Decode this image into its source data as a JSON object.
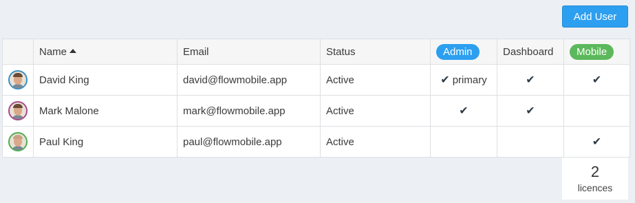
{
  "toolbar": {
    "add_user_label": "Add User"
  },
  "table": {
    "columns": {
      "name": "Name",
      "email": "Email",
      "status": "Status",
      "admin": "Admin",
      "dashboard": "Dashboard",
      "mobile": "Mobile"
    },
    "sort": {
      "column": "name",
      "direction": "ascending",
      "icon": "caret-up-icon"
    },
    "role_colors": {
      "admin": "#2d9ff0",
      "mobile": "#5cb85c"
    },
    "check_icon": "checkmark-icon",
    "rows": [
      {
        "name": "David King",
        "email": "david@flowmobile.app",
        "status": "Active",
        "admin": "primary",
        "admin_checked": true,
        "dashboard_checked": true,
        "mobile_checked": true,
        "avatar_ring": "#3b8fc0"
      },
      {
        "name": "Mark Malone",
        "email": "mark@flowmobile.app",
        "status": "Active",
        "admin": "",
        "admin_checked": true,
        "dashboard_checked": true,
        "mobile_checked": false,
        "avatar_ring": "#a84a8a"
      },
      {
        "name": "Paul King",
        "email": "paul@flowmobile.app",
        "status": "Active",
        "admin": "",
        "admin_checked": false,
        "dashboard_checked": false,
        "mobile_checked": true,
        "avatar_ring": "#4caf50"
      }
    ]
  },
  "mobile_licences": {
    "count": "2",
    "label": "licences"
  }
}
